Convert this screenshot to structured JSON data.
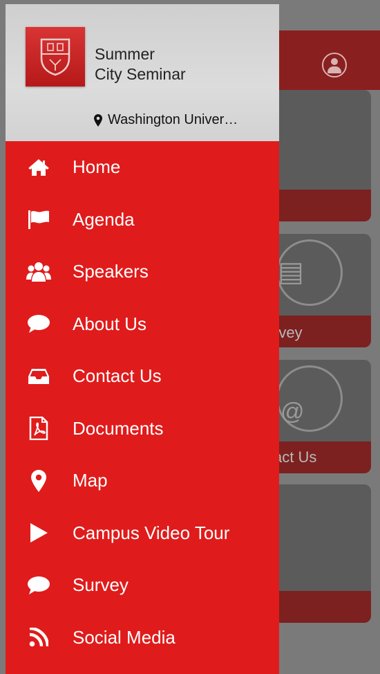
{
  "drawer": {
    "app_title_line1": "Summer",
    "app_title_line2": "City Seminar",
    "location": "Washington Univer…",
    "items": [
      {
        "label": "Home",
        "icon": "home-icon"
      },
      {
        "label": "Agenda",
        "icon": "flag-icon"
      },
      {
        "label": "Speakers",
        "icon": "users-icon"
      },
      {
        "label": "About Us",
        "icon": "chat-bubble-icon"
      },
      {
        "label": "Contact Us",
        "icon": "inbox-icon"
      },
      {
        "label": "Documents",
        "icon": "pdf-file-icon"
      },
      {
        "label": "Map",
        "icon": "map-pin-icon"
      },
      {
        "label": "Campus Video Tour",
        "icon": "play-icon"
      },
      {
        "label": "Survey",
        "icon": "chat-bubble-icon"
      },
      {
        "label": "Social Media",
        "icon": "rss-icon"
      }
    ]
  },
  "background": {
    "survey_label": "rvey",
    "contact_label": "act Us"
  },
  "colors": {
    "drawer_red": "#e01b1b",
    "header_gray": "#d6d6d6",
    "dim_red": "#7d2020"
  }
}
